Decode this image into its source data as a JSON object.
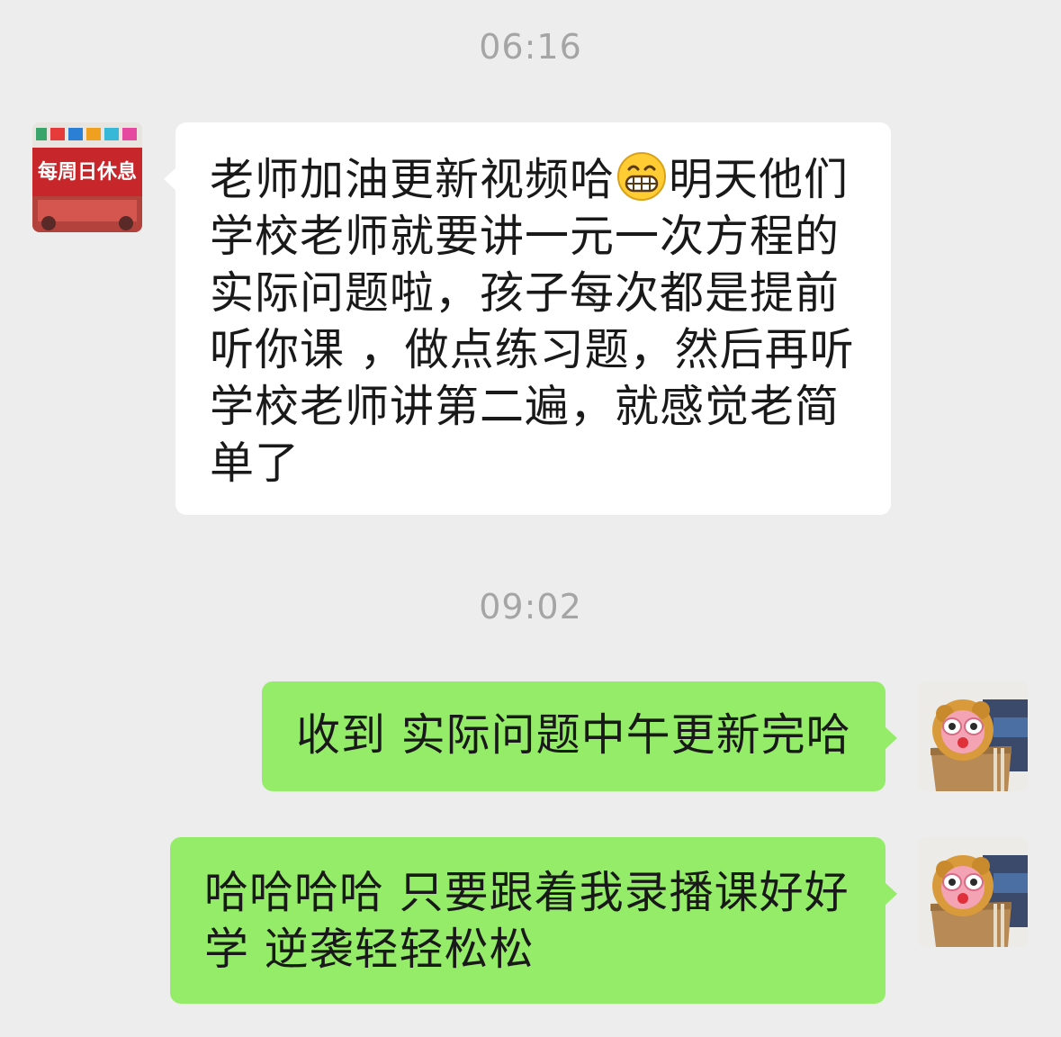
{
  "messages": [
    {
      "time": "06:16",
      "sender": "contact",
      "avatar_sign_text": "每周日休息",
      "text_before_emoji": "老师加油更新视频哈",
      "emoji": "grinning-face-emoji",
      "text_after_emoji": "明天他们学校老师就要讲一元一次方程的实际问题啦，孩子每次都是提前听你课 ，做点练习题，然后再听学校老师讲第二遍，就感觉老简单了"
    },
    {
      "time": "09:02",
      "sender": "me",
      "text": "收到 实际问题中午更新完哈"
    },
    {
      "sender": "me",
      "text": "哈哈哈哈 只要跟着我录播课好好学 逆袭轻轻松松"
    }
  ],
  "colors": {
    "background": "#ededed",
    "incoming_bubble": "#ffffff",
    "outgoing_bubble": "#95ec69",
    "timestamp": "#a5a5a5",
    "text": "#191919"
  }
}
